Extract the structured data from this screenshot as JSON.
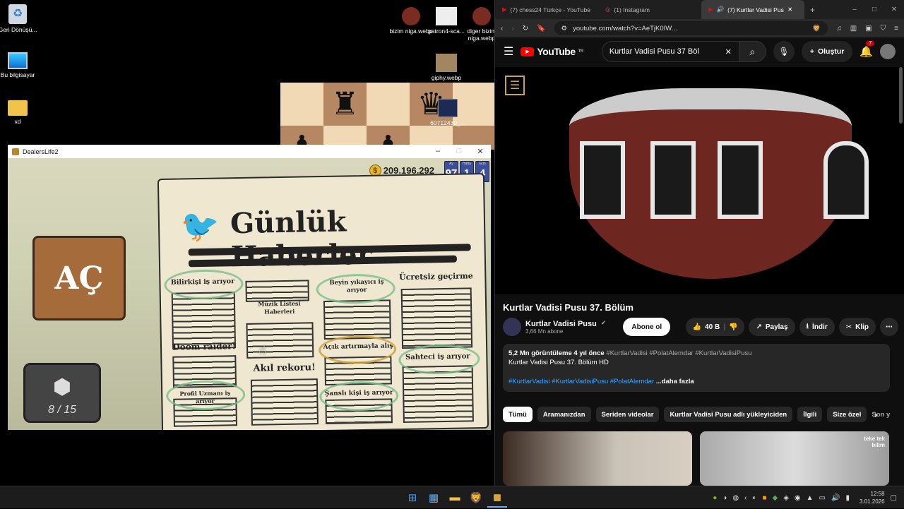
{
  "desktop": {
    "icons": [
      {
        "name": "recycle-bin",
        "label": "Geri Dönüşü..."
      },
      {
        "name": "this-pc",
        "label": "Bu bilgisayar"
      },
      {
        "name": "folder-xd",
        "label": "xd"
      },
      {
        "name": "bizim-niga",
        "label": "bizim niga.webp"
      },
      {
        "name": "patron4",
        "label": "patron4-sca..."
      },
      {
        "name": "diger-bizim",
        "label": "diger bizim niga.webp"
      },
      {
        "name": "giphy",
        "label": "giphy.webp"
      },
      {
        "name": "video-file",
        "label": "60712430_..."
      }
    ]
  },
  "game": {
    "title": "DealersLife2",
    "money": "209.196.292",
    "date_labels": [
      "Ay",
      "Hafta",
      "Gün"
    ],
    "date_values": [
      "97",
      "1",
      "4"
    ],
    "sign": "AÇ",
    "counter": "8 / 15",
    "newspaper_title": "Günlük Haberler",
    "ads": [
      "Bilirkişi iş arıyor",
      "Müzik Listesi Haberleri",
      "Beyin yıkayıcı iş arıyor",
      "Ücretsiz geçirme",
      "Doom raider!",
      "Açık artırmayla alış",
      "Akıl rekoru!",
      "Sahteci iş arıyor",
      "Profil Uzmanı iş arıyor",
      "Şanslı kişi iş arıyor"
    ]
  },
  "browser": {
    "tabs": [
      {
        "label": "(7) chess24 Türkçe - YouTube"
      },
      {
        "label": "(1) Instagram"
      },
      {
        "label": "(7) Kurtlar Vadisi Pusu 3..."
      }
    ],
    "url": "youtube.com/watch?v=AeTjK0IW...",
    "youtube": {
      "logo": "YouTube",
      "region": "TR",
      "search_value": "Kurtlar Vadisi Pusu 37 Böl",
      "create_label": "Oluştur",
      "notif_count": "7",
      "video_title": "Kurtlar Vadisi Pusu 37. Bölüm",
      "channel": "Kurtlar Vadisi Pusu",
      "subs": "3,66 Mn abone",
      "subscribe": "Abone ol",
      "likes": "40 B",
      "share": "Paylaş",
      "download": "İndir",
      "clip": "Klip",
      "views": "5,2 Mn görüntüleme  4 yıl önce",
      "tags_inline": "#KurtlarVadisi #PolatAlemdar #KurtlarVadisiPusu",
      "desc_line": "Kurtlar Vadisi Pusu 37. Bölüm HD",
      "desc_tags": "#KurtlarVadisi #KurtlarVadisiPusu #PolatAlemdar",
      "more": "...daha fazla",
      "chips": [
        "Tümü",
        "Aramanızdan",
        "Seriden videolar",
        "Kurtlar Vadisi Pusu adlı yükleyiciden",
        "İlgili",
        "Size özel",
        "Son y"
      ],
      "thumb_label": "teke tek bilim"
    }
  },
  "taskbar": {
    "time": "12:58",
    "date": "3.01.2026"
  },
  "colors": {
    "yt_red": "#ff0000",
    "bg": "#0f0f0f",
    "chip": "#272727"
  }
}
